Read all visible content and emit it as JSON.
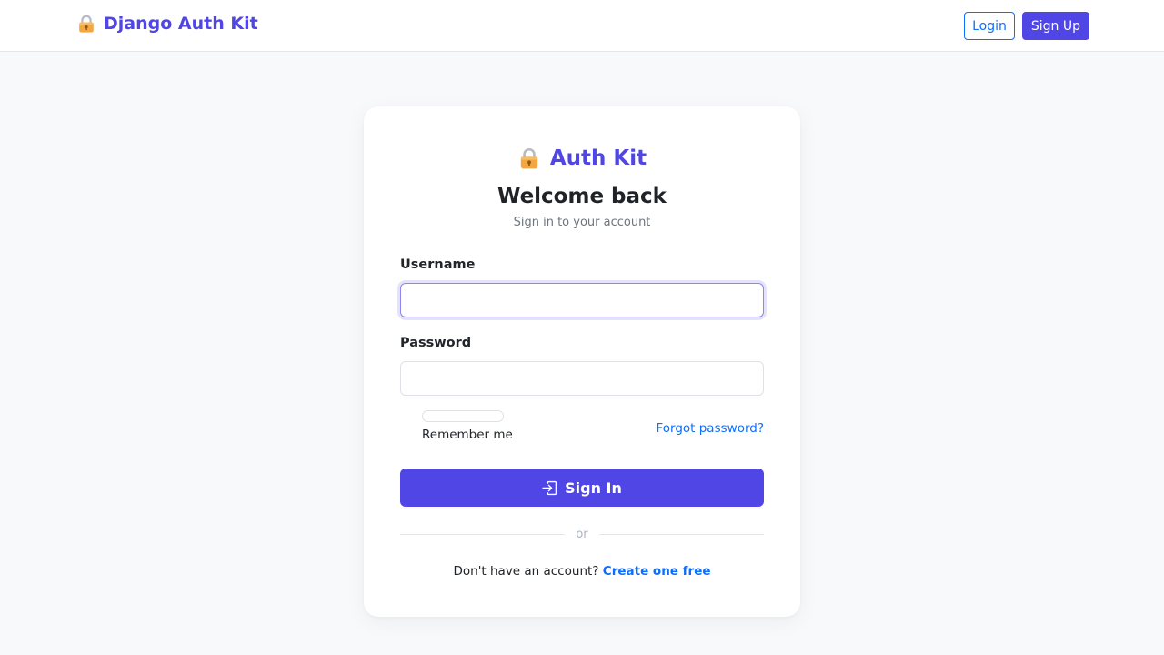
{
  "navbar": {
    "brand_name": "Django Auth Kit",
    "brand_icon": "lock-icon",
    "login_label": "Login",
    "signup_label": "Sign Up"
  },
  "card": {
    "brand_name": "Auth Kit",
    "brand_icon": "lock-icon",
    "title": "Welcome back",
    "subtitle": "Sign in to your account",
    "username_label": "Username",
    "username_value": "",
    "password_label": "Password",
    "password_value": "",
    "remember_label": "Remember me",
    "forgot_label": "Forgot password?",
    "signin_label": "Sign In",
    "signin_icon": "sign-in-icon",
    "divider_text": "or",
    "signup_prompt": "Don't have an account?",
    "signup_link": "Create one free"
  },
  "colors": {
    "brand": "#4f46e5",
    "link": "#0d6efd",
    "background": "#f8f9fb"
  }
}
